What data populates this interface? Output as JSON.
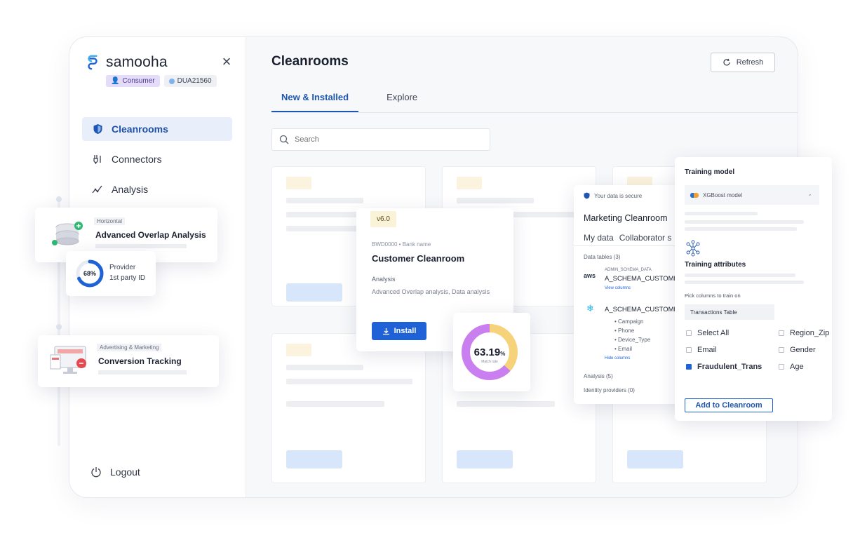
{
  "brand": {
    "name": "samooha",
    "logo_icon": "samooha-logo-icon"
  },
  "header_badges": {
    "role": "Consumer",
    "account": "DUA21560"
  },
  "nav": {
    "items": [
      {
        "label": "Cleanrooms",
        "icon": "shield-icon",
        "active": true
      },
      {
        "label": "Connectors",
        "icon": "plug-icon",
        "active": false
      },
      {
        "label": "Analysis",
        "icon": "chart-icon",
        "active": false
      }
    ],
    "logout": "Logout"
  },
  "main": {
    "title": "Cleanrooms",
    "refresh_label": "Refresh",
    "tabs": [
      {
        "label": "New & Installed",
        "active": true
      },
      {
        "label": "Explore",
        "active": false
      }
    ],
    "search_placeholder": "Search"
  },
  "overlap_card": {
    "badge": "Horizontal",
    "title": "Advanced Overlap Analysis"
  },
  "provider_card": {
    "percent": "68%",
    "percent_value": 68,
    "line1": "Provider",
    "line2": "1st party ID"
  },
  "conversion_card": {
    "badge": "Advertising & Marketing",
    "title": "Conversion Tracking"
  },
  "customer_card": {
    "version": "v6.0",
    "subtitle": "BWD0000 • Bank name",
    "title": "Customer Cleanroom",
    "label": "Analysis",
    "description": "Advanced Overlap analysis, Data analysis",
    "install_label": "Install"
  },
  "donut_card": {
    "value": "63.19",
    "unit": "%",
    "fraction": 0.6319,
    "caption": "Match rate",
    "color_main": "#c97ff0",
    "color_rest": "#f6d27a"
  },
  "marketing_card": {
    "secure": "Your data is secure",
    "title": "Marketing Cleanroom",
    "tabs": [
      "My data",
      "Collaborator s"
    ],
    "section_tables": "Data tables (3)",
    "row1_small": "ADMIN_SCHEMA_DATA",
    "row1_title": "A_SCHEMA_CUSTOMER",
    "row1_link": "View columns",
    "row2_title": "A_SCHEMA_CUSTOMER",
    "row2_items": [
      "Campaign",
      "Phone",
      "Device_Type",
      "Email"
    ],
    "row2_link": "Hide columns",
    "section_analysis": "Analysis (5)",
    "section_identity": "Identity providers (0)",
    "aws_label": "aws"
  },
  "training_card": {
    "title": "Training model",
    "model": "XGBoost model",
    "attributes_title": "Training attributes",
    "pick_label": "Pick columns to train on",
    "table": "Transactions Table",
    "checks": [
      {
        "label": "Select All",
        "checked": false
      },
      {
        "label": "Region_Zip",
        "checked": false
      },
      {
        "label": "Email",
        "checked": false
      },
      {
        "label": "Gender",
        "checked": false
      },
      {
        "label": "Fraudulent_Trans",
        "checked": true
      },
      {
        "label": "Age",
        "checked": false
      }
    ],
    "add_label": "Add to Cleanroom"
  },
  "colors": {
    "accent": "#1f62d8",
    "active_bg": "#e8effb",
    "consumer_badge": "#e4dcf9"
  }
}
